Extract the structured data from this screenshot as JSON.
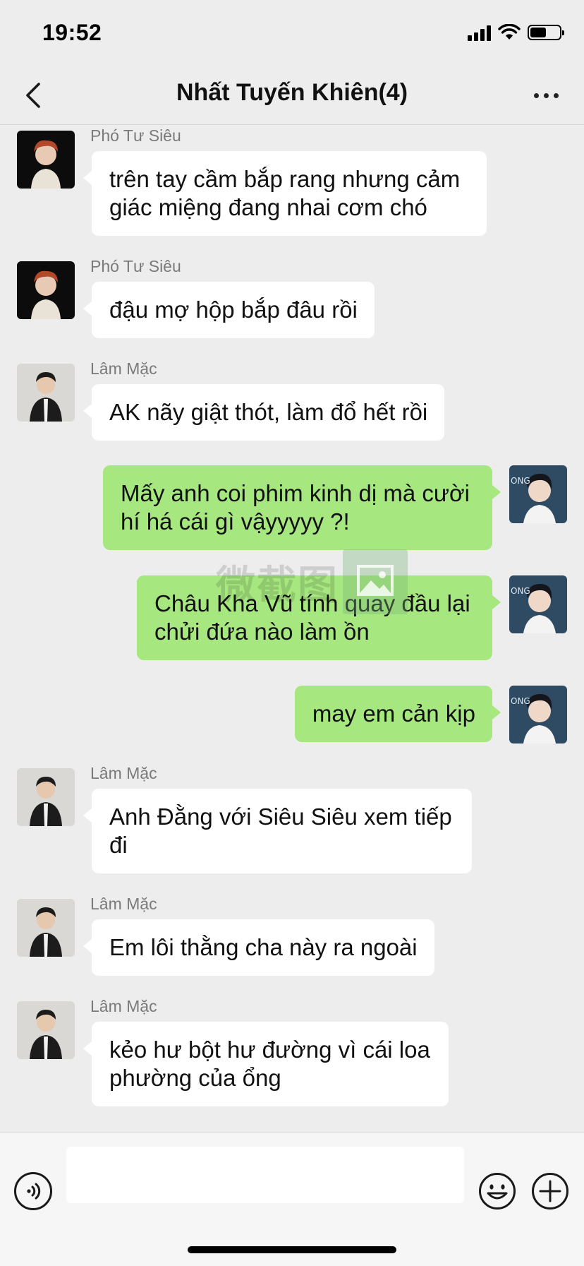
{
  "status": {
    "time": "19:52"
  },
  "header": {
    "title": "Nhất Tuyến Khiên(4)"
  },
  "watermark": {
    "text": "微截图"
  },
  "messages": [
    {
      "side": "left",
      "sender": "Phó Tư Siêu",
      "text": "trên tay cầm bắp rang nhưng cảm giác miệng đang nhai cơm chó",
      "avatar": "pho-tu-sieu"
    },
    {
      "side": "left",
      "sender": "Phó Tư Siêu",
      "text": "đậu mợ hộp bắp đâu rồi",
      "avatar": "pho-tu-sieu"
    },
    {
      "side": "left",
      "sender": "Lâm Mặc",
      "text": "AK nãy giật thót, làm đổ hết rồi",
      "avatar": "lam-mac"
    },
    {
      "side": "right",
      "sender": "",
      "text": "Mấy anh coi phim kinh dị mà cười hí há cái gì vậyyyyy ?!",
      "avatar": "self"
    },
    {
      "side": "right",
      "sender": "",
      "text": "Châu Kha Vũ tính quay đầu lại chửi đứa nào làm ồn",
      "avatar": "self"
    },
    {
      "side": "right",
      "sender": "",
      "text": "may em cản kịp",
      "avatar": "self"
    },
    {
      "side": "left",
      "sender": "Lâm Mặc",
      "text": "Anh Đằng với Siêu Siêu xem tiếp đi",
      "avatar": "lam-mac"
    },
    {
      "side": "left",
      "sender": "Lâm Mặc",
      "text": "Em lôi thằng cha này ra ngoài",
      "avatar": "lam-mac"
    },
    {
      "side": "left",
      "sender": "Lâm Mặc",
      "text": "kẻo hư bột hư đường vì cái loa phường của ổng",
      "avatar": "lam-mac"
    }
  ],
  "input": {
    "value": "",
    "placeholder": ""
  },
  "icons": {
    "back": "chevron-left-icon",
    "more": "more-dots-icon",
    "voice": "voice-icon",
    "emoji": "emoji-icon",
    "plus": "plus-icon"
  },
  "colors": {
    "background": "#ededed",
    "bubble_self": "#a6e77f",
    "bubble_other": "#ffffff",
    "sender_name": "#7a7a7a"
  }
}
